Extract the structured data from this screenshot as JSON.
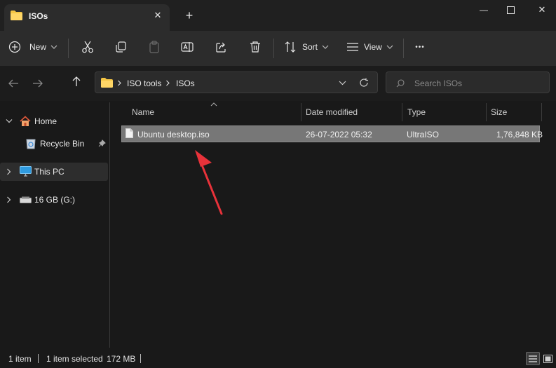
{
  "window": {
    "tab_title": "ISOs",
    "new_tab_label": "+",
    "minimize_label": "—",
    "close_label": "✕"
  },
  "toolbar": {
    "new_label": "New",
    "sort_label": "Sort",
    "view_label": "View",
    "more_label": "•••"
  },
  "address": {
    "breadcrumb": [
      "ISO tools",
      "ISOs"
    ],
    "search_placeholder": "Search ISOs"
  },
  "nav": {
    "items": [
      {
        "label": "Home"
      },
      {
        "label": "Recycle Bin"
      },
      {
        "label": "This PC"
      },
      {
        "label": "16 GB (G:)"
      }
    ]
  },
  "columns": [
    "Name",
    "Date modified",
    "Type",
    "Size"
  ],
  "files": [
    {
      "name": "Ubuntu desktop.iso",
      "date": "26-07-2022 05:32",
      "type": "UltraISO",
      "size": "1,76,848 KB"
    }
  ],
  "status": {
    "item_count": "1 item",
    "selected": "1 item selected",
    "selected_size": "172 MB"
  },
  "colors": {
    "background": "#191919",
    "selection": "#777777",
    "folder": "#f4c545",
    "annotation_arrow": "#e8323a"
  }
}
